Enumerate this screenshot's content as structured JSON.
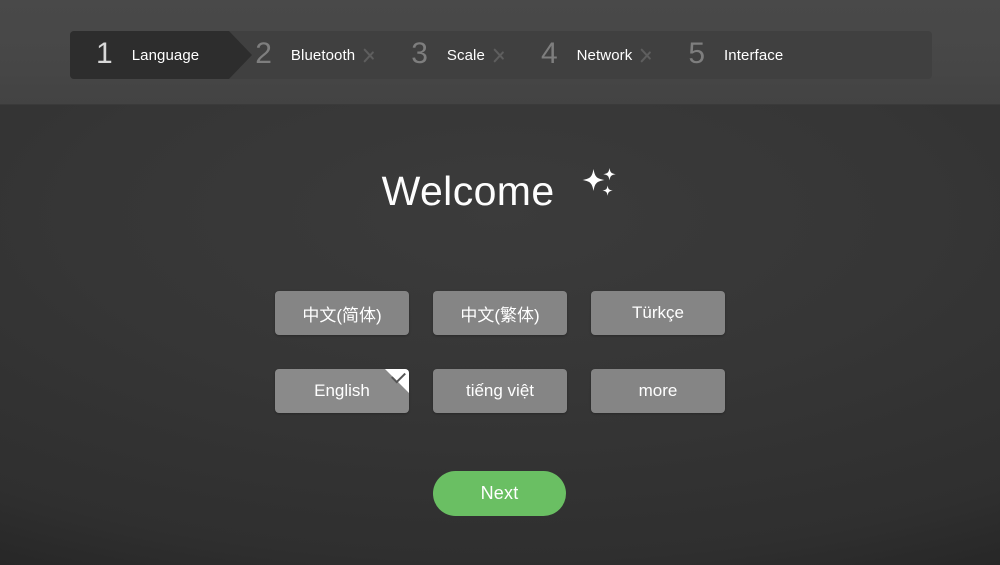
{
  "wizard": {
    "steps": [
      {
        "number": "1",
        "label": "Language",
        "active": true
      },
      {
        "number": "2",
        "label": "Bluetooth",
        "active": false
      },
      {
        "number": "3",
        "label": "Scale",
        "active": false
      },
      {
        "number": "4",
        "label": "Network",
        "active": false
      },
      {
        "number": "5",
        "label": "Interface",
        "active": false
      }
    ]
  },
  "main": {
    "title": "Welcome",
    "title_icon": "sparkles-icon",
    "languages": [
      {
        "label": "中文(简体)",
        "selected": false,
        "cjk": true
      },
      {
        "label": "中文(繁体)",
        "selected": false,
        "cjk": true
      },
      {
        "label": "Türkçe",
        "selected": false,
        "cjk": false
      },
      {
        "label": "English",
        "selected": true,
        "cjk": false
      },
      {
        "label": "tiếng việt",
        "selected": false,
        "cjk": false
      },
      {
        "label": "more",
        "selected": false,
        "cjk": false
      }
    ],
    "next_label": "Next"
  },
  "colors": {
    "accent_green": "#6abf63",
    "header_bg": "#474747",
    "stepbar_bg": "#404040",
    "step_active_bg": "#2d2d2d",
    "button_gray": "#858585",
    "page_bg": "#343434"
  }
}
